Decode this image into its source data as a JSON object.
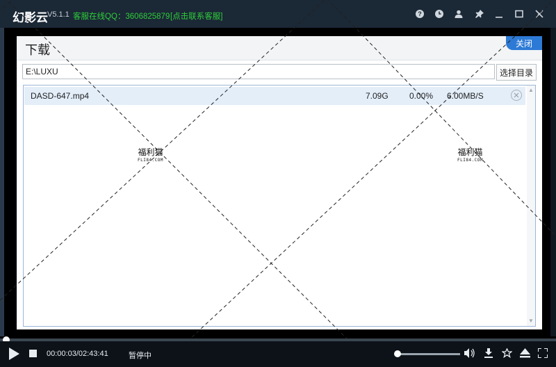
{
  "titlebar": {
    "app_name": "幻影云",
    "version": "V5.1.1",
    "service_text": "客服在线QQ：3606825879",
    "contact_link": "[点击联系客服]"
  },
  "dialog": {
    "title": "下载",
    "close_label": "关闭",
    "path_value": "E:\\LUXU",
    "choose_dir_label": "选择目录",
    "downloads": [
      {
        "name": "DASD-647.mp4",
        "size": "7.09G",
        "progress": "0.00%",
        "speed": "6.00MB/S"
      }
    ]
  },
  "watermark": {
    "text": "福利猫",
    "sub": "FLI84.COM"
  },
  "player": {
    "time": "00:00:03/02:43:41",
    "status": "暂停中",
    "progress_fraction": 0.0003,
    "volume_fraction": 0.0
  }
}
